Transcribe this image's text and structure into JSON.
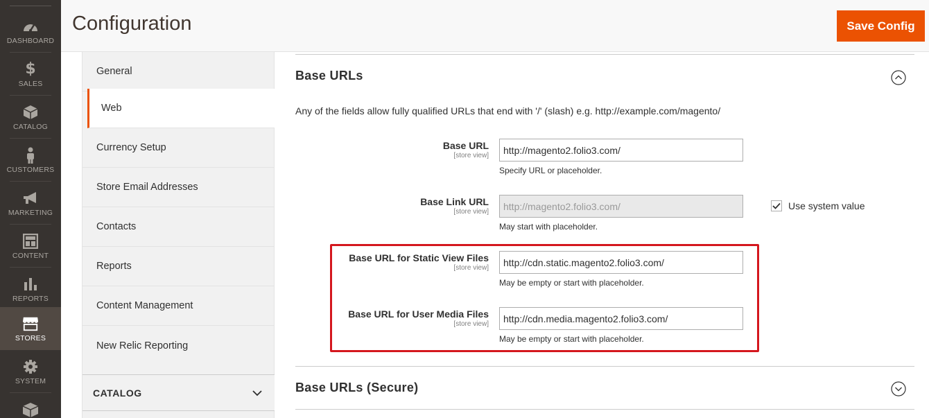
{
  "nav": {
    "items": [
      {
        "label": "DASHBOARD",
        "icon": "dashboard-icon"
      },
      {
        "label": "SALES",
        "icon": "dollar-icon"
      },
      {
        "label": "CATALOG",
        "icon": "box-icon"
      },
      {
        "label": "CUSTOMERS",
        "icon": "person-icon"
      },
      {
        "label": "MARKETING",
        "icon": "megaphone-icon"
      },
      {
        "label": "CONTENT",
        "icon": "layout-icon"
      },
      {
        "label": "REPORTS",
        "icon": "bar-chart-icon"
      },
      {
        "label": "STORES",
        "icon": "storefront-icon"
      },
      {
        "label": "SYSTEM",
        "icon": "gear-icon"
      }
    ],
    "active": "STORES"
  },
  "header": {
    "title": "Configuration",
    "save_label": "Save Config"
  },
  "tabs": {
    "items": [
      {
        "label": "General"
      },
      {
        "label": "Web"
      },
      {
        "label": "Currency Setup"
      },
      {
        "label": "Store Email Addresses"
      },
      {
        "label": "Contacts"
      },
      {
        "label": "Reports"
      },
      {
        "label": "Content Management"
      },
      {
        "label": "New Relic Reporting"
      }
    ],
    "active": "Web",
    "group": "CATALOG"
  },
  "section": {
    "title": "Base URLs",
    "description": "Any of the fields allow fully qualified URLs that end with '/' (slash) e.g. http://example.com/magento/",
    "fields": [
      {
        "label": "Base URL",
        "scope": "[store view]",
        "value": "http://magento2.folio3.com/",
        "note": "Specify URL or placeholder."
      },
      {
        "label": "Base Link URL",
        "scope": "[store view]",
        "value": "http://magento2.folio3.com/",
        "note": "May start with placeholder.",
        "use_system": "Use system value"
      },
      {
        "label": "Base URL for Static View Files",
        "scope": "[store view]",
        "value": "http://cdn.static.magento2.folio3.com/",
        "note": "May be empty or start with placeholder."
      },
      {
        "label": "Base URL for User Media Files",
        "scope": "[store view]",
        "value": "http://cdn.media.magento2.folio3.com/",
        "note": "May be empty or start with placeholder."
      }
    ]
  },
  "section2": {
    "title": "Base URLs (Secure)"
  },
  "colors": {
    "accent": "#eb5202",
    "nav_bg": "#373330",
    "highlight": "#d4171e"
  }
}
